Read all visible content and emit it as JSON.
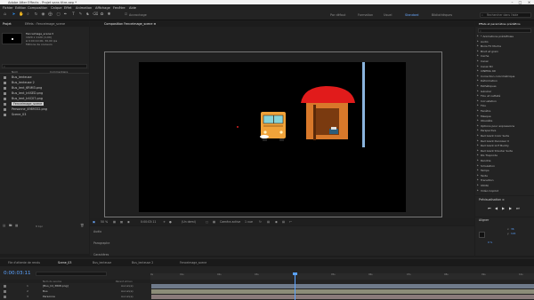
{
  "title": "Adobe After Effects - Projet sans titre.aep *",
  "menu": [
    "Fichier",
    "Edition",
    "Composition",
    "Calque",
    "Effet",
    "Animation",
    "Affichage",
    "Fenêtre",
    "Aide"
  ],
  "toolbar": {
    "snapping_label": "Accrochage",
    "workspaces": [
      "Par défaut",
      "Formation",
      "Usuel",
      "Standard",
      "Bibliothèques"
    ],
    "active_workspace_index": 3,
    "search_placeholder": "Rechercher dans l'aide"
  },
  "project": {
    "tab_label": "Projet",
    "effects_tab_label": "Effets : Fenceimage_scene",
    "item_title": "Fenceimage_scene ▾",
    "item_line1": "1920 x 1120 (1,00)",
    "item_line2": "Δ 0:00:10:00, 30,00 ips",
    "item_line3": "Millions de couleurs",
    "column_name": "Nom",
    "column_comment": "Commentaire",
    "files": [
      {
        "name": "Bus_lenteuse",
        "highlighted": false
      },
      {
        "name": "Bus_lenteuse 2",
        "highlighted": false
      },
      {
        "name": "Bus_lent_6RIM3.png",
        "highlighted": false
      },
      {
        "name": "Bus_lent_Ir4SED.png",
        "highlighted": false
      },
      {
        "name": "Bus_lent_Ir4C07.png",
        "highlighted": false
      },
      {
        "name": "Fenceimage_scene",
        "highlighted": true
      },
      {
        "name": "Personne_4989332.png",
        "highlighted": false
      },
      {
        "name": "Scene_03",
        "highlighted": false
      }
    ],
    "bpc": "8 bpc"
  },
  "comp": {
    "tab_label": "Composition Fenceimage_scene ≡",
    "zoom": "50 %",
    "time": "0:00:03:11",
    "resolution": "(Un demi)",
    "camera": "Caméra active",
    "views": "1 vue"
  },
  "midpanel": {
    "audio": "Audio",
    "paragraph": "Paragraphe",
    "caracteres": "Caractères"
  },
  "effects": {
    "tab_label": "Effets et paramètres prédéfinis",
    "search_placeholder": "⌕",
    "items": [
      "* Animations prédéfinies",
      "Audio",
      "Boris FX Mocha",
      "Bruit et grain",
      "Cache",
      "Canal",
      "Canal 3D",
      "CINEMA 4D",
      "Correction colorimétrique",
      "Déformation",
      "Esthétiques",
      "Générer",
      "Flou et netteté",
      "Incrustation",
      "Flou",
      "Fenêtre",
      "Masque",
      "Obsolète",
      "Options pour expressions",
      "Perspective",
      "Red Giant Color Suite",
      "Red Giant Denoiser II",
      "Red Giant LUT Buddy",
      "Red Giant Shooter Suite",
      "RG Trapcode",
      "Rendrie",
      "Simulation",
      "Temps",
      "Texte",
      "Transition",
      "Utilité",
      "Vidéo Copilot"
    ]
  },
  "preview": {
    "label": "Prévisualisation ≡"
  },
  "align": {
    "label": "Aligner",
    "x_label": "x",
    "y_label": "y",
    "x_val": "36",
    "y_val": "124",
    "pct": "0 %"
  },
  "timeline": {
    "tabs": [
      "File d'attente de rendu",
      "Scene_03",
      "Bus_lenteuse",
      "Bus_lenteuse 2",
      "Fenceimage_scene"
    ],
    "active_tab_index": 1,
    "timecode": "0:00:03:11",
    "ruler": [
      "0s",
      "01s",
      "02s",
      "03s",
      "04s",
      "05s",
      "06s",
      "07s",
      "08s",
      "09s",
      "10s"
    ],
    "col_name": "Nom du source",
    "col_parent": "Parent et lien",
    "layers": [
      {
        "num": "1",
        "name": "[Bus_lid_3808.png]",
        "parent": "Aucun(e)"
      },
      {
        "num": "2",
        "name": "Bus",
        "parent": "Aucun(e)"
      },
      {
        "num": "3",
        "name": "Personne",
        "parent": "Aucun(e)"
      }
    ]
  },
  "colors": {
    "accent": "#2d8ceb",
    "timecode": "#5aa2ff",
    "bus": "#f0a33a",
    "umbrella": "#e11b1b",
    "shelter": "#d8782a"
  }
}
